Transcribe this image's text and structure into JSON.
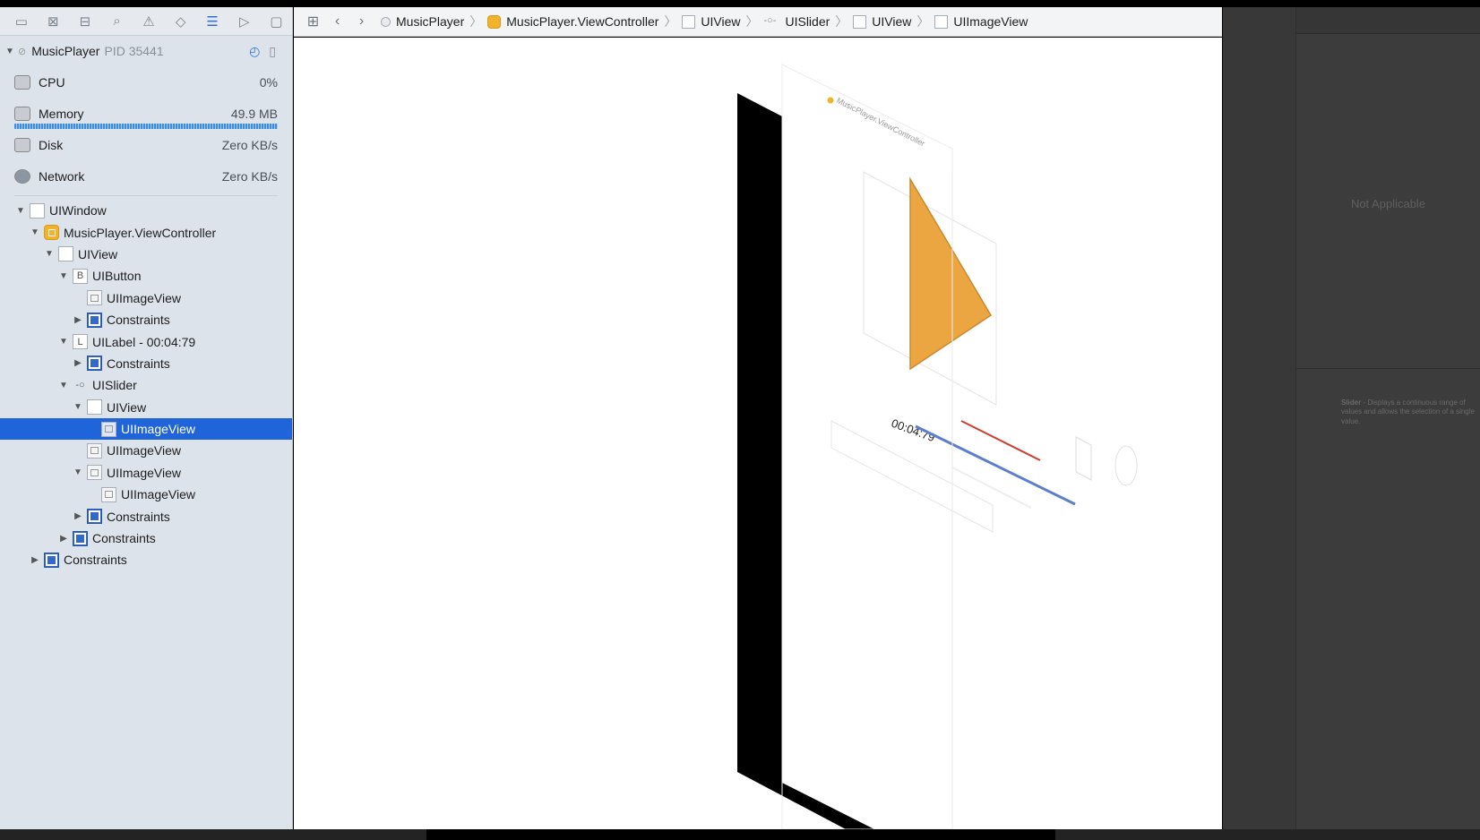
{
  "navigator": {
    "toolbar_icons": [
      "folder-icon",
      "source-control-icon",
      "symbol-icon",
      "find-icon",
      "issue-icon",
      "test-icon",
      "debug-icon",
      "breakpoint-icon",
      "report-icon"
    ],
    "process": {
      "name": "MusicPlayer",
      "pid": "PID 35441"
    },
    "gauges": [
      {
        "label": "CPU",
        "value": "0%"
      },
      {
        "label": "Memory",
        "value": "49.9 MB"
      },
      {
        "label": "Disk",
        "value": "Zero KB/s"
      },
      {
        "label": "Network",
        "value": "Zero KB/s"
      }
    ],
    "tree": [
      {
        "label": "UIWindow",
        "depth": 0,
        "icon": "plain",
        "open": true
      },
      {
        "label": "MusicPlayer.ViewController",
        "depth": 1,
        "icon": "vc",
        "open": true
      },
      {
        "label": "UIView",
        "depth": 2,
        "icon": "plain",
        "open": true
      },
      {
        "label": "UIButton",
        "depth": 3,
        "icon": "letter",
        "glyph": "B",
        "open": true
      },
      {
        "label": "UIImageView",
        "depth": 4,
        "icon": "img"
      },
      {
        "label": "Constraints",
        "depth": 4,
        "icon": "cons",
        "open": false
      },
      {
        "label": "UILabel - 00:04:79",
        "depth": 3,
        "icon": "letter",
        "glyph": "L",
        "open": true
      },
      {
        "label": "Constraints",
        "depth": 4,
        "icon": "cons",
        "open": false
      },
      {
        "label": "UISlider",
        "depth": 3,
        "icon": "slider",
        "open": true
      },
      {
        "label": "UIView",
        "depth": 4,
        "icon": "plain",
        "open": true
      },
      {
        "label": "UIImageView",
        "depth": 5,
        "icon": "img",
        "selected": true
      },
      {
        "label": "UIImageView",
        "depth": 4,
        "icon": "img"
      },
      {
        "label": "UIImageView",
        "depth": 4,
        "icon": "img",
        "open": true
      },
      {
        "label": "UIImageView",
        "depth": 5,
        "icon": "img"
      },
      {
        "label": "Constraints",
        "depth": 4,
        "icon": "cons",
        "open": false
      },
      {
        "label": "Constraints",
        "depth": 3,
        "icon": "cons",
        "open": false
      },
      {
        "label": "Constraints",
        "depth": 1,
        "icon": "cons",
        "open": false
      }
    ]
  },
  "jumpbar": {
    "crumbs": [
      {
        "label": "MusicPlayer",
        "icon": "circle"
      },
      {
        "label": "MusicPlayer.ViewController",
        "icon": "vc"
      },
      {
        "label": "UIView",
        "icon": "plain"
      },
      {
        "label": "UISlider",
        "icon": "slider"
      },
      {
        "label": "UIView",
        "icon": "plain"
      },
      {
        "label": "UIImageView",
        "icon": "plain"
      }
    ]
  },
  "canvas": {
    "vc_caption": "MusicPlayer.ViewController",
    "time_label": "00:04:79",
    "play_color": "#eca641",
    "track_min_color": "#d23b2b",
    "track_max_color": "#5b7fcc"
  },
  "inspector": {
    "not_applicable": "Not Applicable",
    "slider_title": "Slider",
    "slider_desc": " - Displays a continuous range of values and allows the selection of a single value."
  }
}
